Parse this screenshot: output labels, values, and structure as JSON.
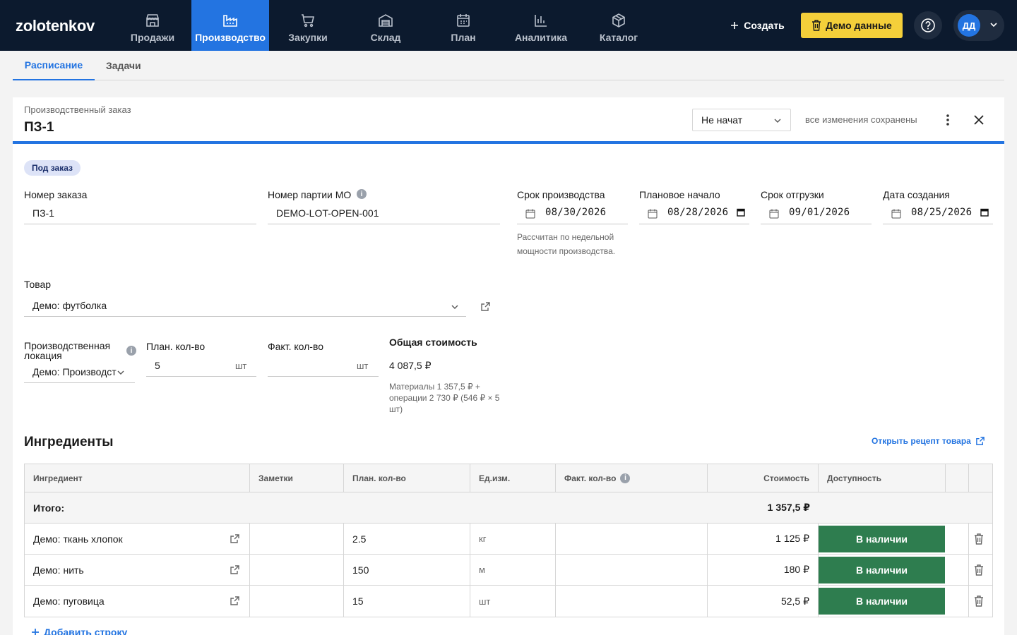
{
  "app": {
    "logo": "zolotenkov"
  },
  "nav": {
    "items": [
      {
        "label": "Продажи",
        "icon": "store-icon"
      },
      {
        "label": "Производство",
        "icon": "factory-icon"
      },
      {
        "label": "Закупки",
        "icon": "cart-icon"
      },
      {
        "label": "Склад",
        "icon": "warehouse-icon"
      },
      {
        "label": "План",
        "icon": "calendar-icon"
      },
      {
        "label": "Аналитика",
        "icon": "bar-chart-icon"
      },
      {
        "label": "Каталог",
        "icon": "box-icon"
      }
    ],
    "active": "Производство",
    "create_label": "Создать",
    "demo_label": "Демо данные",
    "avatar_initials": "ДД"
  },
  "tabs": [
    {
      "label": "Расписание",
      "active": true
    },
    {
      "label": "Задачи",
      "active": false
    }
  ],
  "order": {
    "kind_label": "Производственный заказ",
    "title": "ПЗ-1",
    "status": "Не начат",
    "saved_text": "все изменения сохранены",
    "badge": "Под заказ"
  },
  "fields": {
    "order_number": {
      "label": "Номер заказа",
      "value": "ПЗ-1"
    },
    "batch": {
      "label": "Номер партии МО",
      "value": "DEMO-LOT-OPEN-001"
    },
    "production_deadline": {
      "label": "Срок производства",
      "value": "08/30/2026",
      "helper": "Рассчитан по недельной мощности производства."
    },
    "planned_start": {
      "label": "Плановое начало",
      "value": "08/28/2026"
    },
    "ship_deadline": {
      "label": "Срок отгрузки",
      "value": "09/01/2026"
    },
    "created": {
      "label": "Дата создания",
      "value": "08/25/2026"
    },
    "product": {
      "label": "Товар",
      "value": "Демо: футболка"
    },
    "location": {
      "label": "Производственная локация",
      "value": "Демо: Производст"
    },
    "plan_qty": {
      "label": "План. кол-во",
      "value": "5",
      "unit": "шт"
    },
    "fact_qty": {
      "label": "Факт. кол-во",
      "value": "",
      "unit": "шт"
    },
    "total_cost": {
      "label": "Общая стоимость",
      "value": "4 087,5 ₽",
      "breakdown": "Материалы 1 357,5 ₽ + операции 2 730 ₽ (546 ₽ × 5 шт)"
    }
  },
  "ingredients": {
    "title": "Ингредиенты",
    "recipe_link": "Открыть рецепт товара",
    "columns": [
      "Ингредиент",
      "Заметки",
      "План. кол-во",
      "Ед.изм.",
      "Факт. кол-во",
      "Стоимость",
      "Доступность"
    ],
    "total_label": "Итого:",
    "total_value": "1 357,5 ₽",
    "rows": [
      {
        "name": "Демо: ткань хлопок",
        "notes": "",
        "plan": "2.5",
        "unit": "кг",
        "fact": "",
        "cost": "1 125 ₽",
        "availability": "В наличии"
      },
      {
        "name": "Демо: нить",
        "notes": "",
        "plan": "150",
        "unit": "м",
        "fact": "",
        "cost": "180 ₽",
        "availability": "В наличии"
      },
      {
        "name": "Демо: пуговица",
        "notes": "",
        "plan": "15",
        "unit": "шт",
        "fact": "",
        "cost": "52,5 ₽",
        "availability": "В наличии"
      }
    ],
    "add_row": "Добавить строку"
  },
  "colors": {
    "nav_bg": "#0c1a2e",
    "accent": "#2374e1",
    "demo_button": "#f4cf3a",
    "available": "#2e7d4f"
  }
}
